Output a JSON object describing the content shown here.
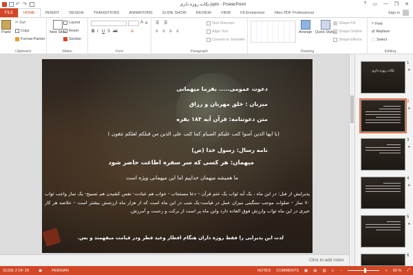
{
  "window": {
    "title": "نکات روزه داری.pptx - PowerPoint",
    "controls": [
      "?",
      "▭",
      "—",
      "❐",
      "✕"
    ]
  },
  "tabs": {
    "file": "FILE",
    "items": [
      "HOME",
      "INSERT",
      "DESIGN",
      "TRANSITIONS",
      "ANIMATIONS",
      "SLIDE SHOW",
      "REVIEW",
      "VIEW",
      "FILEminimizer",
      "Nitro PDF Professional"
    ],
    "active_index": 0,
    "sign_in": "Sign in"
  },
  "ribbon": {
    "clipboard": {
      "label": "Clipboard",
      "paste": "Paste",
      "cut": "Cut",
      "copy": "Copy",
      "format_painter": "Format Painter"
    },
    "slides": {
      "label": "Slides",
      "new_slide": "New Slide",
      "layout": "Layout",
      "reset": "Reset",
      "section": "Section"
    },
    "font": {
      "label": "Font"
    },
    "paragraph": {
      "label": "Paragraph",
      "text_direction": "Text Direction",
      "align_text": "Align Text",
      "convert_smartart": "Convert to SmartArt"
    },
    "drawing": {
      "label": "Drawing",
      "arrange": "Arrange",
      "quick_styles": "Quick Styles",
      "shape_fill": "Shape Fill",
      "shape_outline": "Shape Outline",
      "shape_effects": "Shape Effects"
    },
    "editing": {
      "label": "Editing",
      "find": "Find",
      "replace": "Replace",
      "select": "Select"
    }
  },
  "slide": {
    "line1": "دعوت عمومی..... بفرما میهمانی",
    "line2": "میزبان : خلق مهربان و رزاق",
    "line3": "متن دعوتنامه: قرآن آیه ۱۸۳ بقره",
    "line4": "(یا ایها الذین آمنوا کتب علیکم الصیام کما کتب علی الذین من قبلکم لعلکم تتقون )",
    "line5": "نامه رسال: رسول خدا (ص)",
    "line6": "میهمان: هر کسی که سر سفره اطاعت حاضر شود",
    "line7": "ما همیشه میهمان خداییم اما این میهمانی ویژه است",
    "paragraph": "پذیرایش از قبل: در این ماه ، یک آیه ثواب یک ختم قرآن – دعا مستجاب - خواب هم عبادت- نفس کشیدن هم تسبیح- یک نماز واجب ثواب ۷۰ نماز – صلوات موجب سنگینی میزان عمل در قیامت-یک شب در این ماه است که از هزار ماه ارزشش بیشتر است – خلاصه هر کار خیری در این ماه ثواب وارزش فوق العاده دارد واین ماه پر است از برکت و رحمت و آمرزش.",
    "line_last": "لذت این پذیرایی را فقط روزه داران هنگام افطار وعید فطر ودر قیامت میفهمند و بس."
  },
  "notes_placeholder": "Click to add notes",
  "thumbnails": [
    {
      "num": "1",
      "title": "نکات روزه داری"
    },
    {
      "num": "2",
      "title": ""
    },
    {
      "num": "3",
      "title": ""
    },
    {
      "num": "4",
      "title": ""
    },
    {
      "num": "5",
      "title": ""
    },
    {
      "num": "6",
      "title": ""
    }
  ],
  "status": {
    "slide": "SLIDE 2 OF 29",
    "language": "PERSIAN",
    "notes": "NOTES",
    "comments": "COMMENTS",
    "zoom": "93 %"
  },
  "colors": {
    "accent": "#d24726"
  }
}
